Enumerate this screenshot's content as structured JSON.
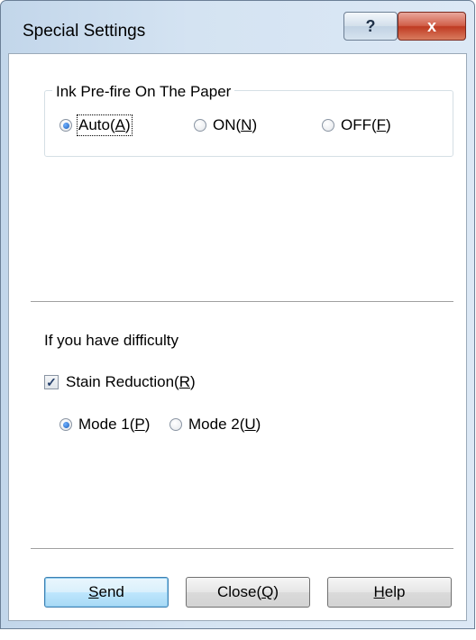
{
  "window": {
    "title": "Special Settings",
    "help_glyph": "?",
    "close_glyph": "x"
  },
  "ink_prefire": {
    "group_label": "Ink Pre-fire On The Paper",
    "options": [
      {
        "label_text": "Auto(",
        "mnemonic": "A",
        "suffix": ")",
        "checked": true
      },
      {
        "label_text": "ON(",
        "mnemonic": "N",
        "suffix": ")",
        "checked": false
      },
      {
        "label_text": "OFF(",
        "mnemonic": "F",
        "suffix": ")",
        "checked": false
      }
    ]
  },
  "difficulty": {
    "heading": "If you have difficulty",
    "stain_reduction": {
      "label_text": "Stain Reduction(",
      "mnemonic": "R",
      "suffix": ")",
      "checked": true
    },
    "modes": [
      {
        "label_text": "Mode 1(",
        "mnemonic": "P",
        "suffix": ")",
        "checked": true
      },
      {
        "label_text": "Mode 2(",
        "mnemonic": "U",
        "suffix": ")",
        "checked": false
      }
    ]
  },
  "buttons": {
    "send": {
      "mnemonic": "S",
      "rest": "end"
    },
    "close": {
      "label_text": "Close(",
      "mnemonic": "Q",
      "suffix": ")"
    },
    "help": {
      "mnemonic": "H",
      "rest": "elp"
    }
  },
  "colors": {
    "accent_radio": "#1d5fb8",
    "close_button": "#c7432a",
    "frame": "#d4e3f2"
  }
}
